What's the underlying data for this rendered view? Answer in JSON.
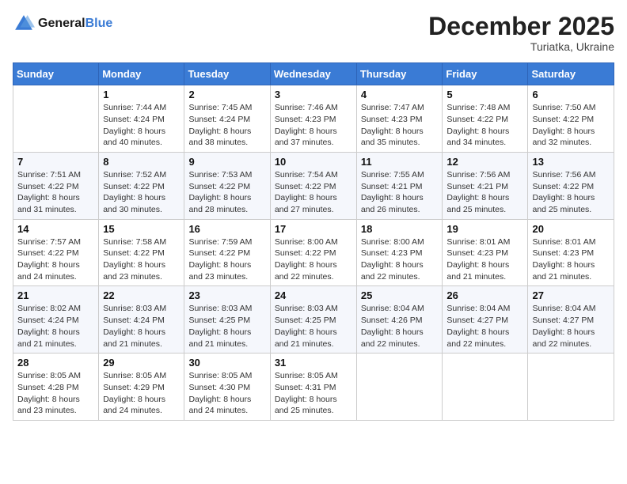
{
  "header": {
    "logo_line1": "General",
    "logo_line2": "Blue",
    "month": "December 2025",
    "location": "Turiatka, Ukraine"
  },
  "days_of_week": [
    "Sunday",
    "Monday",
    "Tuesday",
    "Wednesday",
    "Thursday",
    "Friday",
    "Saturday"
  ],
  "weeks": [
    [
      {
        "num": "",
        "sunrise": "",
        "sunset": "",
        "daylight": ""
      },
      {
        "num": "1",
        "sunrise": "Sunrise: 7:44 AM",
        "sunset": "Sunset: 4:24 PM",
        "daylight": "Daylight: 8 hours and 40 minutes."
      },
      {
        "num": "2",
        "sunrise": "Sunrise: 7:45 AM",
        "sunset": "Sunset: 4:24 PM",
        "daylight": "Daylight: 8 hours and 38 minutes."
      },
      {
        "num": "3",
        "sunrise": "Sunrise: 7:46 AM",
        "sunset": "Sunset: 4:23 PM",
        "daylight": "Daylight: 8 hours and 37 minutes."
      },
      {
        "num": "4",
        "sunrise": "Sunrise: 7:47 AM",
        "sunset": "Sunset: 4:23 PM",
        "daylight": "Daylight: 8 hours and 35 minutes."
      },
      {
        "num": "5",
        "sunrise": "Sunrise: 7:48 AM",
        "sunset": "Sunset: 4:22 PM",
        "daylight": "Daylight: 8 hours and 34 minutes."
      },
      {
        "num": "6",
        "sunrise": "Sunrise: 7:50 AM",
        "sunset": "Sunset: 4:22 PM",
        "daylight": "Daylight: 8 hours and 32 minutes."
      }
    ],
    [
      {
        "num": "7",
        "sunrise": "Sunrise: 7:51 AM",
        "sunset": "Sunset: 4:22 PM",
        "daylight": "Daylight: 8 hours and 31 minutes."
      },
      {
        "num": "8",
        "sunrise": "Sunrise: 7:52 AM",
        "sunset": "Sunset: 4:22 PM",
        "daylight": "Daylight: 8 hours and 30 minutes."
      },
      {
        "num": "9",
        "sunrise": "Sunrise: 7:53 AM",
        "sunset": "Sunset: 4:22 PM",
        "daylight": "Daylight: 8 hours and 28 minutes."
      },
      {
        "num": "10",
        "sunrise": "Sunrise: 7:54 AM",
        "sunset": "Sunset: 4:22 PM",
        "daylight": "Daylight: 8 hours and 27 minutes."
      },
      {
        "num": "11",
        "sunrise": "Sunrise: 7:55 AM",
        "sunset": "Sunset: 4:21 PM",
        "daylight": "Daylight: 8 hours and 26 minutes."
      },
      {
        "num": "12",
        "sunrise": "Sunrise: 7:56 AM",
        "sunset": "Sunset: 4:21 PM",
        "daylight": "Daylight: 8 hours and 25 minutes."
      },
      {
        "num": "13",
        "sunrise": "Sunrise: 7:56 AM",
        "sunset": "Sunset: 4:22 PM",
        "daylight": "Daylight: 8 hours and 25 minutes."
      }
    ],
    [
      {
        "num": "14",
        "sunrise": "Sunrise: 7:57 AM",
        "sunset": "Sunset: 4:22 PM",
        "daylight": "Daylight: 8 hours and 24 minutes."
      },
      {
        "num": "15",
        "sunrise": "Sunrise: 7:58 AM",
        "sunset": "Sunset: 4:22 PM",
        "daylight": "Daylight: 8 hours and 23 minutes."
      },
      {
        "num": "16",
        "sunrise": "Sunrise: 7:59 AM",
        "sunset": "Sunset: 4:22 PM",
        "daylight": "Daylight: 8 hours and 23 minutes."
      },
      {
        "num": "17",
        "sunrise": "Sunrise: 8:00 AM",
        "sunset": "Sunset: 4:22 PM",
        "daylight": "Daylight: 8 hours and 22 minutes."
      },
      {
        "num": "18",
        "sunrise": "Sunrise: 8:00 AM",
        "sunset": "Sunset: 4:23 PM",
        "daylight": "Daylight: 8 hours and 22 minutes."
      },
      {
        "num": "19",
        "sunrise": "Sunrise: 8:01 AM",
        "sunset": "Sunset: 4:23 PM",
        "daylight": "Daylight: 8 hours and 21 minutes."
      },
      {
        "num": "20",
        "sunrise": "Sunrise: 8:01 AM",
        "sunset": "Sunset: 4:23 PM",
        "daylight": "Daylight: 8 hours and 21 minutes."
      }
    ],
    [
      {
        "num": "21",
        "sunrise": "Sunrise: 8:02 AM",
        "sunset": "Sunset: 4:24 PM",
        "daylight": "Daylight: 8 hours and 21 minutes."
      },
      {
        "num": "22",
        "sunrise": "Sunrise: 8:03 AM",
        "sunset": "Sunset: 4:24 PM",
        "daylight": "Daylight: 8 hours and 21 minutes."
      },
      {
        "num": "23",
        "sunrise": "Sunrise: 8:03 AM",
        "sunset": "Sunset: 4:25 PM",
        "daylight": "Daylight: 8 hours and 21 minutes."
      },
      {
        "num": "24",
        "sunrise": "Sunrise: 8:03 AM",
        "sunset": "Sunset: 4:25 PM",
        "daylight": "Daylight: 8 hours and 21 minutes."
      },
      {
        "num": "25",
        "sunrise": "Sunrise: 8:04 AM",
        "sunset": "Sunset: 4:26 PM",
        "daylight": "Daylight: 8 hours and 22 minutes."
      },
      {
        "num": "26",
        "sunrise": "Sunrise: 8:04 AM",
        "sunset": "Sunset: 4:27 PM",
        "daylight": "Daylight: 8 hours and 22 minutes."
      },
      {
        "num": "27",
        "sunrise": "Sunrise: 8:04 AM",
        "sunset": "Sunset: 4:27 PM",
        "daylight": "Daylight: 8 hours and 22 minutes."
      }
    ],
    [
      {
        "num": "28",
        "sunrise": "Sunrise: 8:05 AM",
        "sunset": "Sunset: 4:28 PM",
        "daylight": "Daylight: 8 hours and 23 minutes."
      },
      {
        "num": "29",
        "sunrise": "Sunrise: 8:05 AM",
        "sunset": "Sunset: 4:29 PM",
        "daylight": "Daylight: 8 hours and 24 minutes."
      },
      {
        "num": "30",
        "sunrise": "Sunrise: 8:05 AM",
        "sunset": "Sunset: 4:30 PM",
        "daylight": "Daylight: 8 hours and 24 minutes."
      },
      {
        "num": "31",
        "sunrise": "Sunrise: 8:05 AM",
        "sunset": "Sunset: 4:31 PM",
        "daylight": "Daylight: 8 hours and 25 minutes."
      },
      {
        "num": "",
        "sunrise": "",
        "sunset": "",
        "daylight": ""
      },
      {
        "num": "",
        "sunrise": "",
        "sunset": "",
        "daylight": ""
      },
      {
        "num": "",
        "sunrise": "",
        "sunset": "",
        "daylight": ""
      }
    ]
  ]
}
